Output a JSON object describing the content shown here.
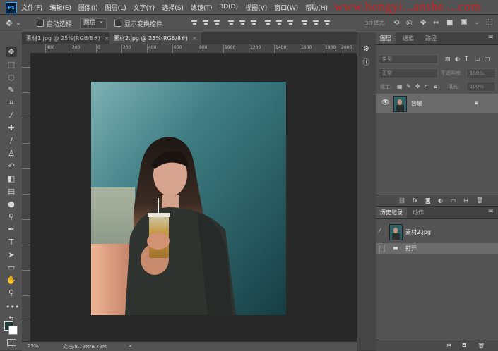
{
  "menu": {
    "logo": "Ps",
    "items": [
      "文件(F)",
      "编辑(E)",
      "图像(I)",
      "图层(L)",
      "文字(Y)",
      "选择(S)",
      "滤镜(T)",
      "3D(D)",
      "视图(V)",
      "窗口(W)",
      "帮助(H)"
    ],
    "watermark": "www.hongyi...anshe....com"
  },
  "options": {
    "auto_select_label": "自动选择:",
    "auto_select_value": "图层",
    "show_transform_label": "显示变换控件",
    "mode_3d_label": "3D 模式:"
  },
  "tabs": [
    {
      "label": "素材1.jpg @ 25%(RGB/8#)",
      "close": "×"
    },
    {
      "label": "素材2.jpg @ 25%(RGB/8#)",
      "close": "×"
    }
  ],
  "ruler": {
    "top": [
      "400",
      "200",
      "0",
      "200",
      "400",
      "600",
      "800",
      "1000",
      "1200",
      "1400",
      "1600",
      "1800",
      "2000"
    ]
  },
  "status": {
    "zoom": "25%",
    "doc_info": "文档:8.79M/8.79M",
    "arrow": ">"
  },
  "layers_panel": {
    "tabs": [
      "图层",
      "通道",
      "路径"
    ],
    "kind_placeholder": "类型",
    "blend_mode": "正常",
    "opacity_label": "不透明度:",
    "opacity_value": "100%",
    "lock_label": "锁定:",
    "fill_label": "填充:",
    "fill_value": "100%",
    "layer_name": "背景"
  },
  "history_panel": {
    "tabs": [
      "历史记录",
      "动作"
    ],
    "snapshot": "素材2.jpg",
    "steps": [
      "打开"
    ]
  },
  "colors": {
    "accent": "#31a8ff",
    "watermark": "#d81e1e",
    "foreground_swatch": "#1e3b3b",
    "background_swatch": "#ffffff"
  }
}
